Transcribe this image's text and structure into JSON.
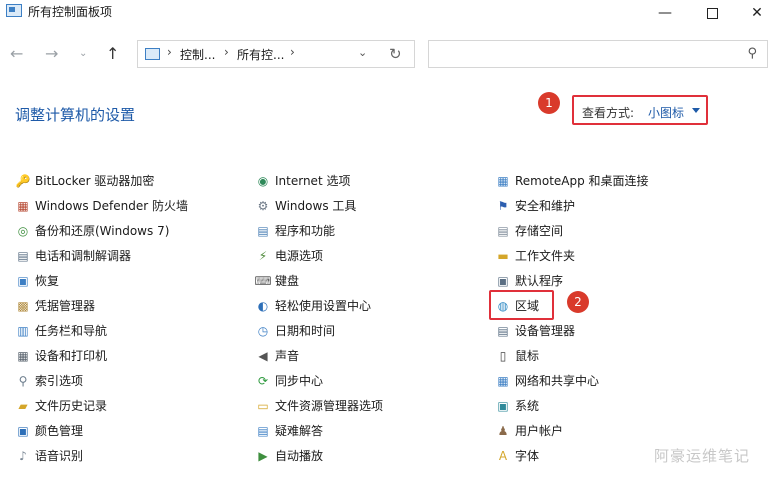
{
  "window": {
    "title": "所有控制面板项"
  },
  "nav": {
    "breadcrumb": [
      "控制...",
      "所有控..."
    ],
    "search_placeholder": ""
  },
  "heading": "调整计算机的设置",
  "view_by": {
    "label": "查看方式:",
    "value": "小图标"
  },
  "annotations": {
    "badge1": "1",
    "badge2": "2"
  },
  "columns": [
    [
      {
        "label": "BitLocker 驱动器加密",
        "icon": "bitlocker-icon",
        "color": "#c9962a",
        "glyph": "🔑"
      },
      {
        "label": "Windows Defender 防火墙",
        "icon": "firewall-icon",
        "color": "#b5462f",
        "glyph": "▦"
      },
      {
        "label": "备份和还原(Windows 7)",
        "icon": "backup-icon",
        "color": "#3f8f3f",
        "glyph": "◎"
      },
      {
        "label": "电话和调制解调器",
        "icon": "phone-modem-icon",
        "color": "#5b6f84",
        "glyph": "▤"
      },
      {
        "label": "恢复",
        "icon": "recovery-icon",
        "color": "#3d7fc4",
        "glyph": "▣"
      },
      {
        "label": "凭据管理器",
        "icon": "credential-icon",
        "color": "#b08a3c",
        "glyph": "▩"
      },
      {
        "label": "任务栏和导航",
        "icon": "taskbar-icon",
        "color": "#3d7fc4",
        "glyph": "▥"
      },
      {
        "label": "设备和打印机",
        "icon": "printer-icon",
        "color": "#56606b",
        "glyph": "▦"
      },
      {
        "label": "索引选项",
        "icon": "indexing-icon",
        "color": "#6b7c8c",
        "glyph": "⚲"
      },
      {
        "label": "文件历史记录",
        "icon": "file-history-icon",
        "color": "#d4a62a",
        "glyph": "▰"
      },
      {
        "label": "颜色管理",
        "icon": "color-management-icon",
        "color": "#2d6fb8",
        "glyph": "▣"
      },
      {
        "label": "语音识别",
        "icon": "speech-icon",
        "color": "#7a8795",
        "glyph": "♪"
      }
    ],
    [
      {
        "label": "Internet 选项",
        "icon": "internet-options-icon",
        "color": "#2f8a5a",
        "glyph": "◉"
      },
      {
        "label": "Windows 工具",
        "icon": "windows-tools-icon",
        "color": "#6b7785",
        "glyph": "⚙"
      },
      {
        "label": "程序和功能",
        "icon": "programs-icon",
        "color": "#4a7fb5",
        "glyph": "▤"
      },
      {
        "label": "电源选项",
        "icon": "power-icon",
        "color": "#4e8a3a",
        "glyph": "⚡"
      },
      {
        "label": "键盘",
        "icon": "keyboard-icon",
        "color": "#666666",
        "glyph": "⌨"
      },
      {
        "label": "轻松使用设置中心",
        "icon": "ease-of-access-icon",
        "color": "#2d6fb8",
        "glyph": "◐"
      },
      {
        "label": "日期和时间",
        "icon": "datetime-icon",
        "color": "#3d7fc4",
        "glyph": "◷"
      },
      {
        "label": "声音",
        "icon": "sound-icon",
        "color": "#555555",
        "glyph": "◀"
      },
      {
        "label": "同步中心",
        "icon": "sync-icon",
        "color": "#2f9a3f",
        "glyph": "⟳"
      },
      {
        "label": "文件资源管理器选项",
        "icon": "explorer-options-icon",
        "color": "#d4a62a",
        "glyph": "▭"
      },
      {
        "label": "疑难解答",
        "icon": "troubleshoot-icon",
        "color": "#3d7fc4",
        "glyph": "▤"
      },
      {
        "label": "自动播放",
        "icon": "autoplay-icon",
        "color": "#3f8f3f",
        "glyph": "▶"
      }
    ],
    [
      {
        "label": "RemoteApp 和桌面连接",
        "icon": "remoteapp-icon",
        "color": "#3d7fc4",
        "glyph": "▦"
      },
      {
        "label": "安全和维护",
        "icon": "security-flag-icon",
        "color": "#2d5fb0",
        "glyph": "⚑"
      },
      {
        "label": "存储空间",
        "icon": "storage-icon",
        "color": "#7a8795",
        "glyph": "▤"
      },
      {
        "label": "工作文件夹",
        "icon": "work-folders-icon",
        "color": "#d4a62a",
        "glyph": "▬"
      },
      {
        "label": "默认程序",
        "icon": "default-programs-icon",
        "color": "#5b6f84",
        "glyph": "▣"
      },
      {
        "label": "区域",
        "icon": "region-globe-icon",
        "color": "#2f8ac4",
        "glyph": "◍"
      },
      {
        "label": "设备管理器",
        "icon": "device-manager-icon",
        "color": "#5b6f84",
        "glyph": "▤"
      },
      {
        "label": "鼠标",
        "icon": "mouse-icon",
        "color": "#444444",
        "glyph": "▯"
      },
      {
        "label": "网络和共享中心",
        "icon": "network-icon",
        "color": "#3d7fc4",
        "glyph": "▦"
      },
      {
        "label": "系统",
        "icon": "system-icon",
        "color": "#2f8a9a",
        "glyph": "▣"
      },
      {
        "label": "用户帐户",
        "icon": "user-accounts-icon",
        "color": "#8a6a4a",
        "glyph": "♟"
      },
      {
        "label": "字体",
        "icon": "fonts-icon",
        "color": "#d4a62a",
        "glyph": "A"
      }
    ]
  ],
  "watermark": "阿豪运维笔记"
}
